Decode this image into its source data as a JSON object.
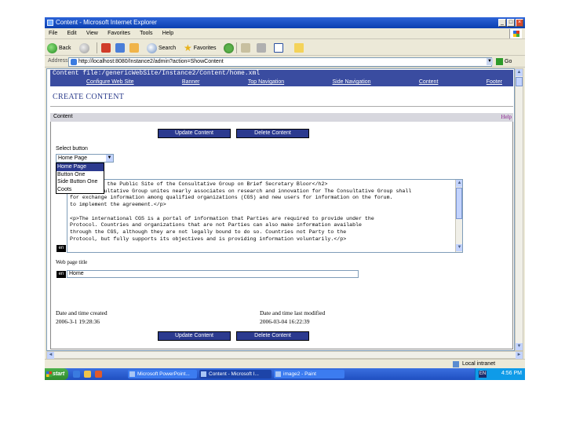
{
  "window": {
    "title": "Content - Microsoft Internet Explorer",
    "controls": {
      "minimize": "_",
      "maximize": "□",
      "close": "×"
    }
  },
  "menu": [
    "File",
    "Edit",
    "View",
    "Favorites",
    "Tools",
    "Help"
  ],
  "toolbar": {
    "back": "Back",
    "search": "Search",
    "favorites": "Favorites"
  },
  "address": {
    "label": "Address",
    "url": "http://localhost:8080/Instance2/admin?action=ShowContent",
    "go": "Go"
  },
  "page": {
    "path": "Content file:/genericWebSite/Instance2/Content/home.xml",
    "nav": [
      "Configure Web Site",
      "Banner",
      "Top Navigation",
      "Side Navigation",
      "Content",
      "Footer"
    ],
    "heading": "CREATE CONTENT",
    "section": "Content",
    "help": "Help",
    "buttons": {
      "update": "Update Content",
      "delete": "Delete Content"
    },
    "select_label": "Select button",
    "select_value": "Home Page",
    "select_options": [
      "Home Page",
      "Button One",
      "Side Button One",
      "Coots"
    ],
    "select_active_index": 0,
    "editor_text": "         on the Public Site of the Consultative Group on Brief Secretary Bloor</h2>\n<p>The Consultative Group unites nearly associates on research and innovation for The Consultative Group shall\nfor exchange information among qualified organizations (CGS) and new users for information on the forum.\nto implement the agreement.</p>\n\n<p>The international CGS is a portal of information that Parties are required to provide under the\nProtocol. Countries and organizations that are not Parties can also make information available\nthrough the CGS, although they are not legally bound to do so. Countries not Party to the\nProtocol, but fully supports its objectives and is providing information voluntarily.</p>",
    "lang_badge": "en",
    "webpage_title_label": "Web page title",
    "webpage_title_value": "Home",
    "created_label": "Date and time created",
    "created_value": "2006-3-1 19:28:36",
    "modified_label": "Date and time last modified",
    "modified_value": "2006-03-04 16:22:39"
  },
  "status": {
    "zone": "Local intranet"
  },
  "taskbar": {
    "start": "start",
    "tasks": [
      "Microsoft PowerPoint...",
      "Content - Microsoft I...",
      "image2 - Paint"
    ],
    "active_task": 1,
    "lang": "EN",
    "time": "4:56 PM"
  }
}
